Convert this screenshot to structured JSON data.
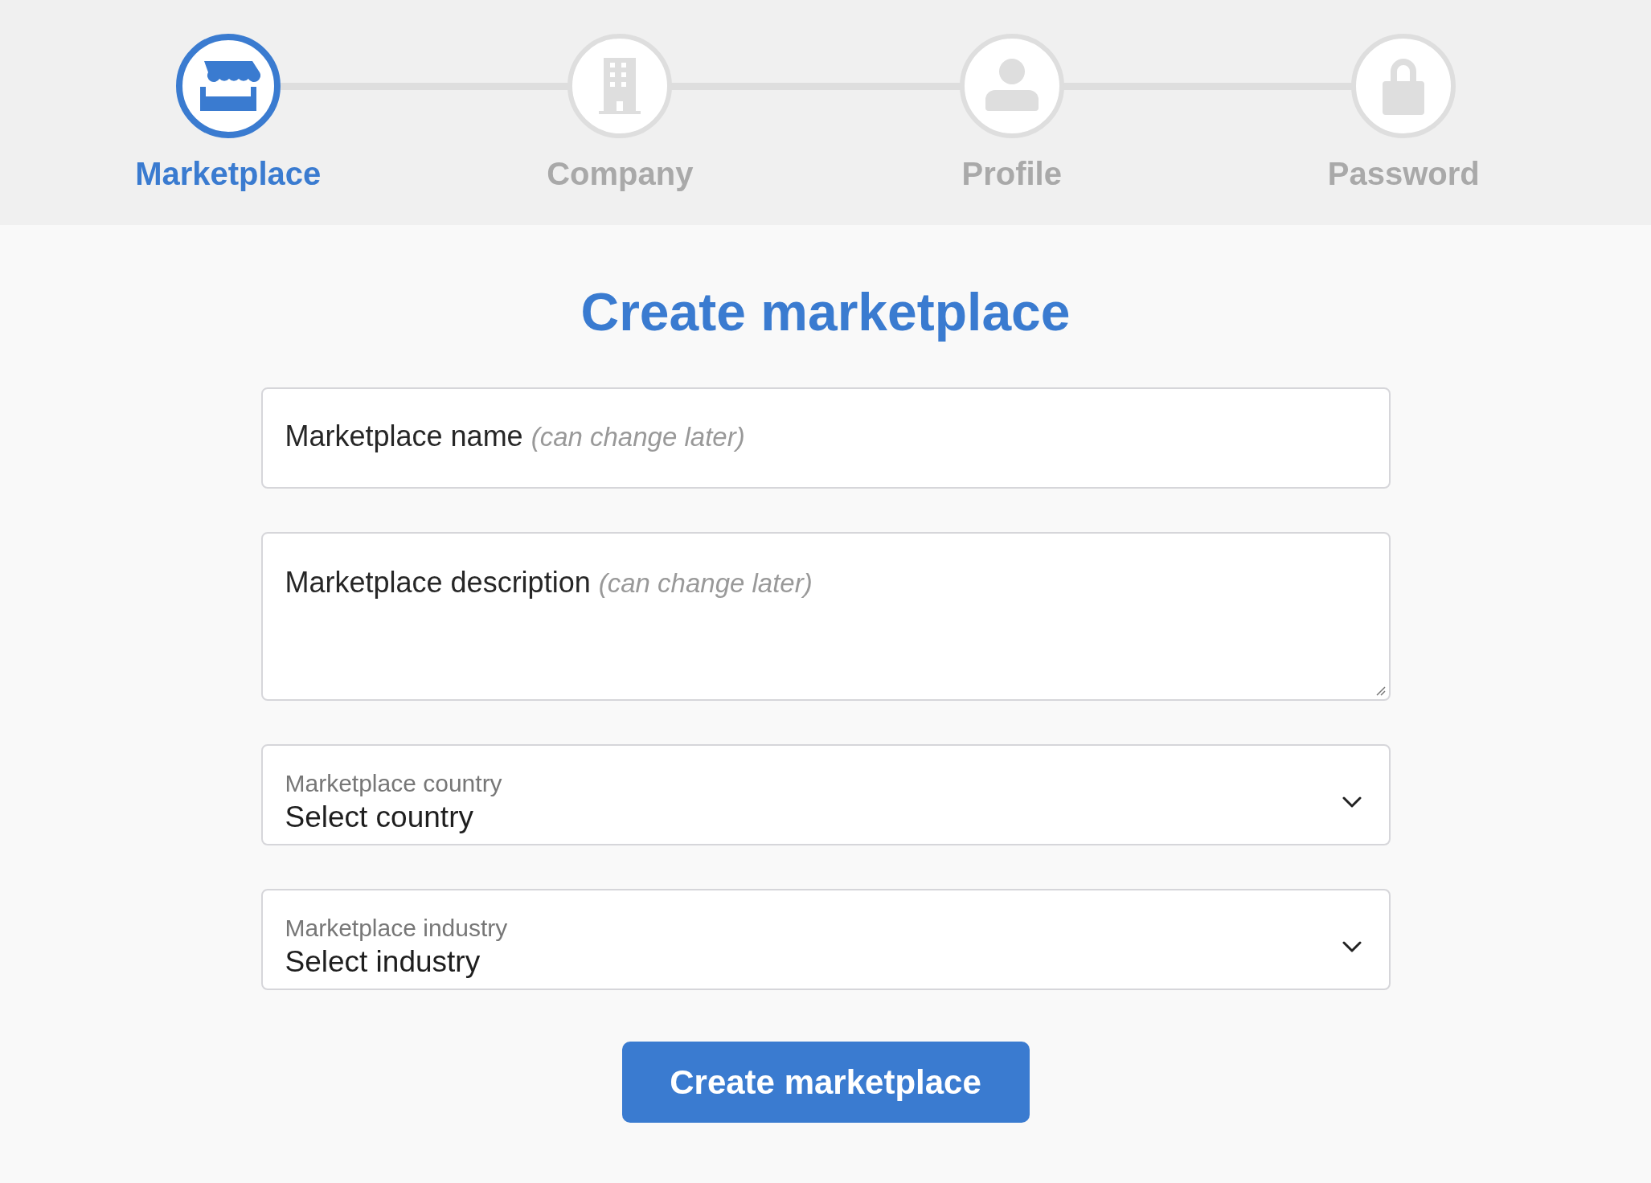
{
  "steps": [
    {
      "label": "Marketplace",
      "kind": "store",
      "selected": true
    },
    {
      "label": "Company",
      "kind": "building",
      "selected": false
    },
    {
      "label": "Profile",
      "kind": "person",
      "selected": false
    },
    {
      "label": "Password",
      "kind": "lock",
      "selected": false
    }
  ],
  "title": "Create marketplace",
  "fields": [
    {
      "kind": "text",
      "label": "Marketplace name",
      "hint": "(can change later)"
    },
    {
      "kind": "textarea",
      "label": "Marketplace description",
      "hint": "(can change later)"
    },
    {
      "kind": "select",
      "label": "Marketplace country",
      "value": "Select country"
    },
    {
      "kind": "select",
      "label": "Marketplace industry",
      "value": "Select industry"
    }
  ],
  "submit": "Create marketplace"
}
